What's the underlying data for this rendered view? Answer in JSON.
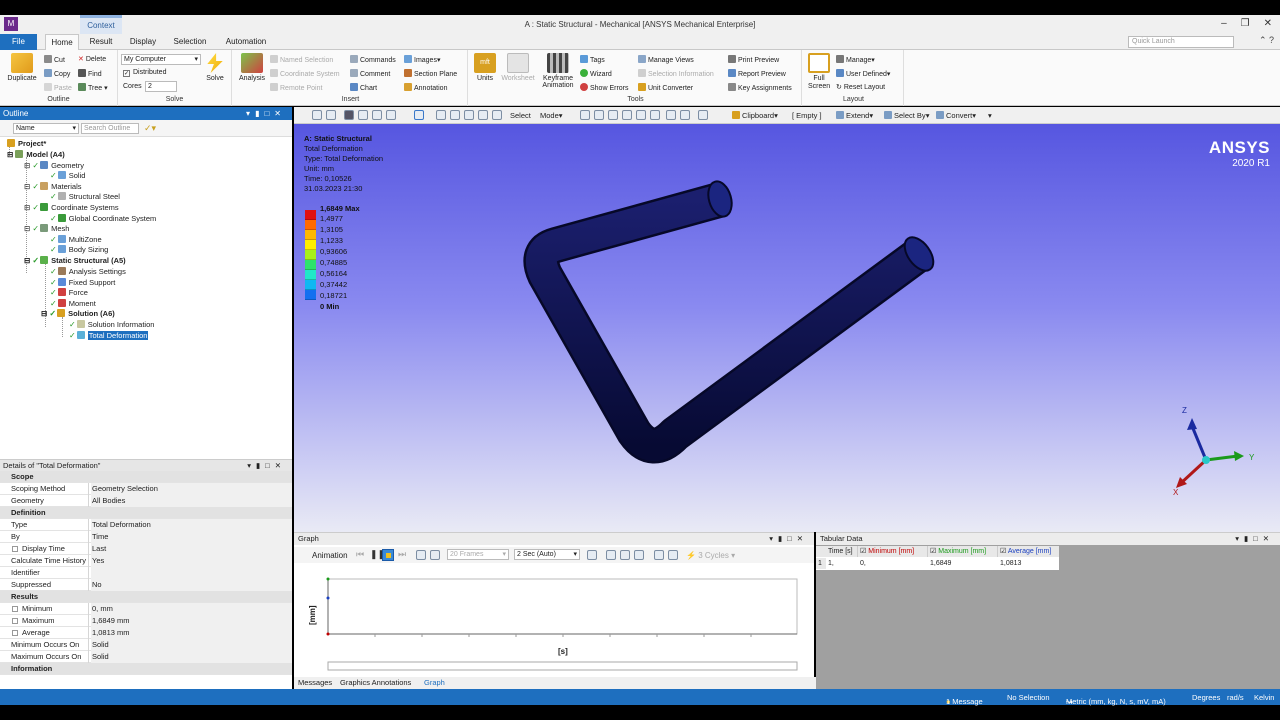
{
  "window": {
    "title": "A : Static Structural - Mechanical [ANSYS Mechanical Enterprise]",
    "context_tab": "Context"
  },
  "ribbon_tabs": [
    "File",
    "Home",
    "Result",
    "Display",
    "Selection",
    "Automation"
  ],
  "quick_launch_placeholder": "Quick Launch",
  "ribbon": {
    "outline": {
      "label": "Outline",
      "duplicate": "Duplicate",
      "cut": "Cut",
      "copy": "Copy",
      "paste": "Paste",
      "delete": "Delete",
      "find": "Find",
      "tree": "Tree"
    },
    "solve": {
      "label": "Solve",
      "computer": "My Computer",
      "distributed": "Distributed",
      "cores_label": "Cores",
      "cores_value": "2",
      "solve_btn": "Solve"
    },
    "insert": {
      "label": "Insert",
      "analysis": "Analysis",
      "named_selection": "Named Selection",
      "coordinate_system": "Coordinate System",
      "remote_point": "Remote Point",
      "commands": "Commands",
      "comment": "Comment",
      "chart": "Chart",
      "images": "Images",
      "section_plane": "Section Plane",
      "annotation": "Annotation"
    },
    "tools": {
      "label": "Tools",
      "units": "Units",
      "worksheet": "Worksheet",
      "keyframe": "Keyframe Animation",
      "tags": "Tags",
      "wizard": "Wizard",
      "show_errors": "Show Errors",
      "manage_views": "Manage Views",
      "selection_information": "Selection Information",
      "unit_converter": "Unit Converter",
      "print_preview": "Print Preview",
      "report_preview": "Report Preview",
      "key_assignments": "Key Assignments"
    },
    "layout": {
      "label": "Layout",
      "full_screen": "Full Screen",
      "manage": "Manage",
      "user_defined": "User Defined",
      "reset_layout": "Reset Layout"
    }
  },
  "toolbar": {
    "select": "Select",
    "mode": "Mode",
    "clipboard": "Clipboard",
    "empty": "[ Empty ]",
    "extend": "Extend",
    "select_by": "Select By",
    "convert": "Convert"
  },
  "outline": {
    "title": "Outline",
    "name_col": "Name",
    "search_placeholder": "Search Outline",
    "nodes": [
      "Project*",
      "Model (A4)",
      "Geometry",
      "Solid",
      "Materials",
      "Structural Steel",
      "Coordinate Systems",
      "Global Coordinate System",
      "Mesh",
      "MultiZone",
      "Body Sizing",
      "Static Structural (A5)",
      "Analysis Settings",
      "Fixed Support",
      "Force",
      "Moment",
      "Solution (A6)",
      "Solution Information",
      "Total Deformation"
    ]
  },
  "details": {
    "title": "Details of \"Total Deformation\"",
    "rows": [
      {
        "section": "Scope"
      },
      {
        "k": "Scoping Method",
        "v": "Geometry Selection"
      },
      {
        "k": "Geometry",
        "v": "All Bodies"
      },
      {
        "section": "Definition"
      },
      {
        "k": "Type",
        "v": "Total Deformation"
      },
      {
        "k": "By",
        "v": "Time"
      },
      {
        "k": "Display Time",
        "v": "Last"
      },
      {
        "k": "Calculate Time History",
        "v": "Yes"
      },
      {
        "k": "Identifier",
        "v": ""
      },
      {
        "k": "Suppressed",
        "v": "No"
      },
      {
        "section": "Results"
      },
      {
        "k": "Minimum",
        "v": "0, mm"
      },
      {
        "k": "Maximum",
        "v": "1,6849 mm"
      },
      {
        "k": "Average",
        "v": "1,0813 mm"
      },
      {
        "k": "Minimum Occurs On",
        "v": "Solid"
      },
      {
        "k": "Maximum Occurs On",
        "v": "Solid"
      },
      {
        "section": "Information"
      }
    ]
  },
  "viewport": {
    "info": [
      "A: Static Structural",
      "Total Deformation",
      "Type: Total Deformation",
      "Unit: mm",
      "Time: 0,10526",
      "31.03.2023 21:30"
    ],
    "legend": [
      {
        "label": "1,6849 Max",
        "color": "#e01010"
      },
      {
        "label": "1,4977",
        "color": "#ff6a00"
      },
      {
        "label": "1,3105",
        "color": "#ffb800"
      },
      {
        "label": "1,1233",
        "color": "#ffee00"
      },
      {
        "label": "0,93606",
        "color": "#a8ef1a"
      },
      {
        "label": "0,74885",
        "color": "#2ee36c"
      },
      {
        "label": "0,56164",
        "color": "#20e8c8"
      },
      {
        "label": "0,37442",
        "color": "#10b8f2"
      },
      {
        "label": "0,18721",
        "color": "#1470f0"
      },
      {
        "label": "0 Min",
        "color": "#1010d0"
      }
    ],
    "brand": "ANSYS",
    "version": "2020 R1",
    "axis_z": "Z",
    "axis_y": "Y",
    "axis_x": "X"
  },
  "graph": {
    "title": "Graph",
    "animation": "Animation",
    "frames": "20 Frames",
    "duration": "2 Sec (Auto)",
    "cycles": "3 Cycles",
    "ylabel": "[mm]",
    "xlabel": "[s]"
  },
  "tabular": {
    "title": "Tabular Data",
    "headers": [
      "Time [s]",
      "Minimum [mm]",
      "Maximum [mm]",
      "Average [mm]"
    ],
    "header_colors": [
      "#222222",
      "#c00000",
      "#1a9a1a",
      "#1a3fc0"
    ],
    "row": [
      "1",
      "1,",
      "0,",
      "1,6849",
      "1,0813"
    ]
  },
  "bottom_tabs": [
    "Messages",
    "Graphics Annotations",
    "Graph"
  ],
  "status": {
    "message": "1 Message",
    "selection": "No Selection",
    "units": "Metric (mm, kg, N, s, mV, mA)",
    "degrees": "Degrees",
    "rads": "rad/s",
    "temp": "Kelvin"
  }
}
